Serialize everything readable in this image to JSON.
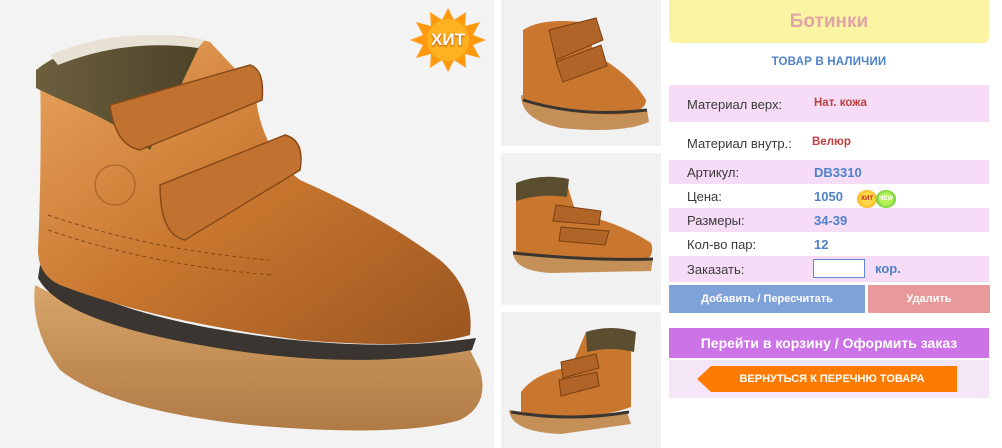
{
  "product": {
    "title": "Ботинки",
    "stock_status": "ТОВАР В НАЛИЧИИ",
    "hit_badge": "ХИТ"
  },
  "specs": {
    "material_upper_label": "Материал верх:",
    "material_upper_value": "Нат. кожа",
    "material_inner_label": "Материал внутр.:",
    "material_inner_value": "Велюр",
    "article_label": "Артикул:",
    "article_value": "DB3310",
    "price_label": "Цена:",
    "price_value": "1050",
    "price_badge_hit": "ХИТ",
    "price_badge_new": "NEW",
    "sizes_label": "Размеры:",
    "sizes_value": "34-39",
    "pairs_label": "Кол-во пар:",
    "pairs_value": "12",
    "order_label": "Заказать:",
    "order_input_value": "",
    "order_unit": "кор."
  },
  "actions": {
    "add_label": "Добавить / Пересчитать",
    "delete_label": "Удалить",
    "cart_label": "Перейти в корзину / Оформить заказ",
    "back_label": "ВЕРНУТЬСЯ К ПЕРЕЧНЮ ТОВАРА"
  },
  "colors": {
    "title_bg": "#fbf4a3",
    "title_text": "#e0a5a5",
    "accent_blue": "#4e82c8",
    "row_pink": "#f6dcf6",
    "cart_purple": "#cd73e8",
    "back_orange": "#ff7a00",
    "add_blue": "#7fa3d9",
    "delete_pink": "#e89a9a"
  }
}
